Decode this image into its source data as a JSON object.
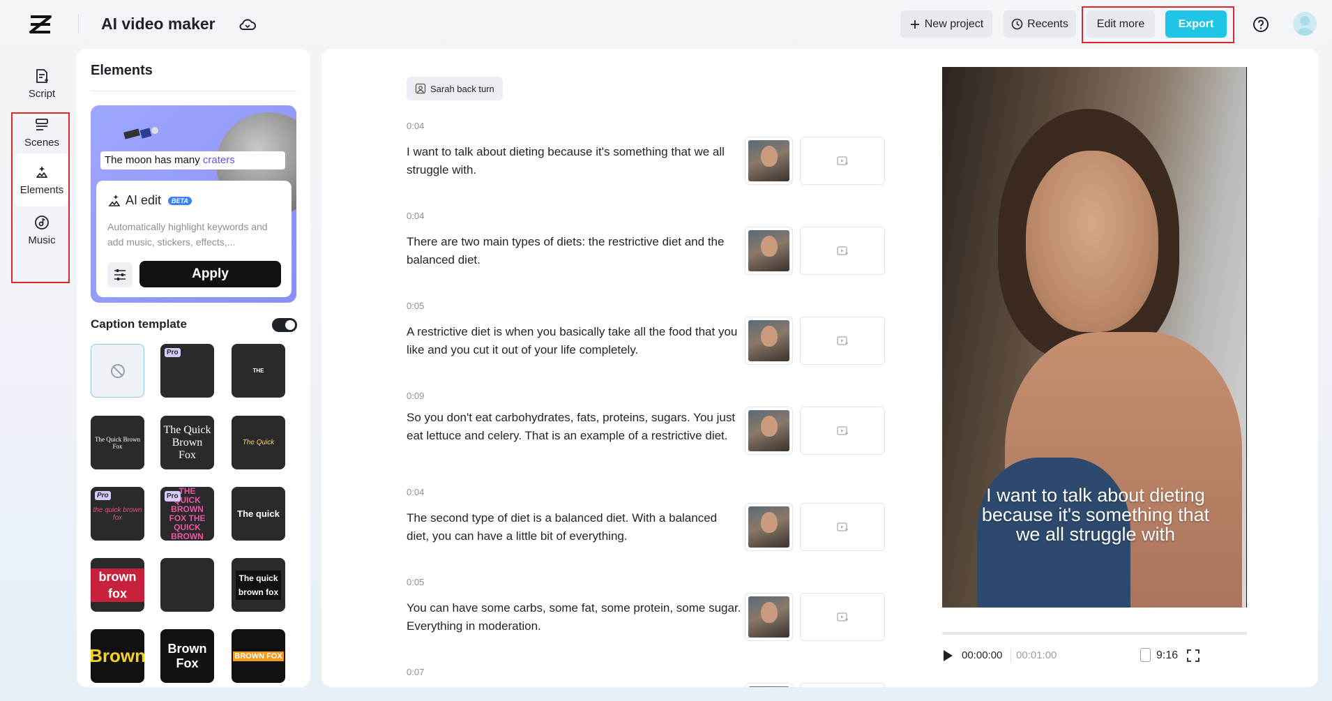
{
  "header": {
    "app_title": "AI video maker",
    "new_project": "New project",
    "recents": "Recents",
    "edit_more": "Edit more",
    "export": "Export"
  },
  "nav": {
    "items": [
      {
        "label": "Script",
        "icon": "script-icon"
      },
      {
        "label": "Scenes",
        "icon": "scenes-icon"
      },
      {
        "label": "Elements",
        "icon": "elements-icon",
        "active": true
      },
      {
        "label": "Music",
        "icon": "music-icon"
      }
    ]
  },
  "elements_panel": {
    "title": "Elements",
    "preview_caption_plain": "The moon has many",
    "preview_caption_highlight": "craters",
    "ai_edit_title": "AI edit",
    "ai_edit_badge": "BETA",
    "ai_edit_desc": "Automatically highlight keywords and add music, stickers, effects,...",
    "apply": "Apply",
    "caption_template_label": "Caption template",
    "caption_template_enabled": true,
    "templates": [
      {
        "label": "",
        "kind": "none"
      },
      {
        "label": "",
        "pro": true
      },
      {
        "label": "THE"
      },
      {
        "label": "The Quick Brown Fox"
      },
      {
        "label": "The Quick Brown Fox"
      },
      {
        "label": "The Quick"
      },
      {
        "label": "the quick brown fox",
        "pro": true
      },
      {
        "label": "THE QUICK BROWN FOX THE QUICK BROWN",
        "pro": true
      },
      {
        "label": "The quick"
      },
      {
        "label": "brown fox"
      },
      {
        "label": ""
      },
      {
        "label": "The quick brown fox"
      },
      {
        "label": "Brown"
      },
      {
        "label": "Brown Fox"
      },
      {
        "label": "BROWN FOX"
      }
    ],
    "pro_badge": "Pro"
  },
  "script": {
    "speaker_chip": "Sarah back turn",
    "segments": [
      {
        "time": "0:04",
        "text": "I want to talk about dieting because it's something that we all struggle with."
      },
      {
        "time": "0:04",
        "text": "There are two main types of diets: the restrictive diet and the balanced diet."
      },
      {
        "time": "0:05",
        "text": "A restrictive diet is when you basically take all the food that you like and you cut it out of your life completely."
      },
      {
        "time": "0:09",
        "text": "So you don't eat carbohydrates, fats, proteins, sugars. You just eat lettuce and celery. That is an example of a restrictive diet."
      },
      {
        "time": "0:04",
        "text": "The second type of diet is a balanced diet. With a balanced diet, you can have a little bit of everything."
      },
      {
        "time": "0:05",
        "text": "You can have some carbs, some fat, some protein, some sugar. Everything in moderation."
      },
      {
        "time": "0:07",
        "text": ""
      }
    ]
  },
  "preview": {
    "caption": "I want to talk about dieting because it's something that we all struggle with",
    "current_time": "00:00:00",
    "total_time": "00:01:00",
    "aspect_ratio": "9:16",
    "progress": 0
  },
  "colors": {
    "accent": "#1ec5e5",
    "highlight_box": "#e0262b",
    "ai_card": "#9ea7ff"
  }
}
